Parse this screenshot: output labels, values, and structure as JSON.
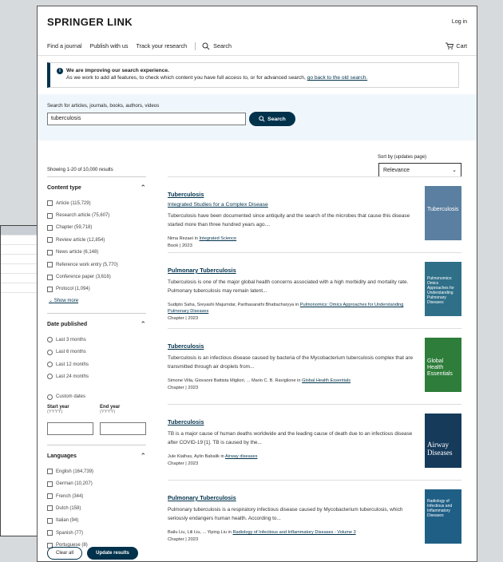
{
  "header": {
    "logo": "SPRINGER LINK",
    "login": "Log in"
  },
  "nav": {
    "find_journal": "Find a journal",
    "publish": "Publish with us",
    "track": "Track your research",
    "search": "Search",
    "cart": "Cart"
  },
  "notice": {
    "title": "We are improving our search experience.",
    "text": "As we work to add all features, to check which content you have full access to, or for advanced search,",
    "link": "go back to the old search."
  },
  "search": {
    "label": "Search for articles, journals, books, authors, videos",
    "value": "tuberculosis",
    "button": "Search"
  },
  "results_meta": {
    "showing": "Showing 1-20 of 10,000 results",
    "sort_label": "Sort by (updates page)",
    "sort_value": "Relevance"
  },
  "filters": {
    "content_type": {
      "title": "Content type",
      "options": [
        "Article (115,729)",
        "Research article (75,607)",
        "Chapter (59,718)",
        "Review article (12,854)",
        "News article (6,148)",
        "Reference work entry (5,770)",
        "Conference paper (3,616)",
        "Protocol (1,094)"
      ],
      "show_more": "Show more"
    },
    "date_published": {
      "title": "Date published",
      "options": [
        "Last 3 months",
        "Last 6 months",
        "Last 12 months",
        "Last 24 months"
      ],
      "custom": "Custom dates",
      "start_label": "Start year",
      "start_hint": "(YYYY)",
      "end_label": "End year",
      "end_hint": "(YYYY)"
    },
    "languages": {
      "title": "Languages",
      "options": [
        "English (164,739)",
        "German (10,207)",
        "French (344)",
        "Dutch (158)",
        "Italian (94)",
        "Spanish (77)",
        "Portuguese (8)"
      ]
    },
    "clear": "Clear all",
    "update": "Update results"
  },
  "results": [
    {
      "title": "Tuberculosis",
      "subtitle": "Integrated Studies for a Complex Disease",
      "snippet": "Tuberculosis have been documented since antiquity and the search of the microbes that cause this disease started more than three hundred years ago....",
      "authors": "Nima Rezaei in",
      "source": "Integrated Science",
      "meta": "Book | 2023",
      "cover_color": "#5a7fa0",
      "cover_text": "Tuberculosis"
    },
    {
      "title": "Pulmonary Tuberculosis",
      "subtitle": "",
      "snippet": "Tuberculosis is one of the major global health concerns associated with a high morbidity and mortality rate. Pulmonary tuberculosis may remain latent...",
      "authors": "Sudipto Saha, Sreyashi Majumdar, Parthasarathi Bhattacharyya in",
      "source": "Pulmonomics: Omics Approaches for Understanding Pulmonary Diseases",
      "meta": "Chapter | 2023",
      "cover_color": "#2f6f88",
      "cover_text": "Pulmonomics: Omics Approaches for Understanding Pulmonary Diseases"
    },
    {
      "title": "Tuberculosis",
      "subtitle": "",
      "snippet": "Tuberculosis is an infectious disease caused by bacteria of the Mycobacterium tuberculosis complex that are transmitted through air droplets from...",
      "authors": "Simone Villa, Giovanni Battista Migliori, ... Mario C. B. Raviglione in",
      "source": "Global Health Essentials",
      "meta": "Chapter | 2023",
      "cover_color": "#2e7d3a",
      "cover_text": "Global Health Essentials"
    },
    {
      "title": "Tuberculosis",
      "subtitle": "",
      "snippet": "TB is a major cause of human deaths worldwide and the leading cause of death due to an infectious disease after COVID-19 [1]. TB is caused by the...",
      "authors": "Jule Kialhas, Aylin Babalik in",
      "source": "Airway diseases",
      "meta": "Chapter | 2023",
      "cover_color": "#163a5a",
      "cover_text": "Airway Diseases"
    },
    {
      "title": "Pulmonary Tuberculosis",
      "subtitle": "",
      "snippet": "Pulmonary tuberculosis is a respiratory infectious disease caused by Mycobacterium tuberculosis, which seriously endangers human health. According to...",
      "authors": "Bailu Liu, Lili Liu, ... Yiping Liu in",
      "source": "Radiology of Infectious and Inflammatory Diseases - Volume 3",
      "meta": "Chapter | 2023",
      "cover_color": "#1f5f86",
      "cover_text": "Radiology of Infectious and Inflammatory Diseases"
    }
  ]
}
